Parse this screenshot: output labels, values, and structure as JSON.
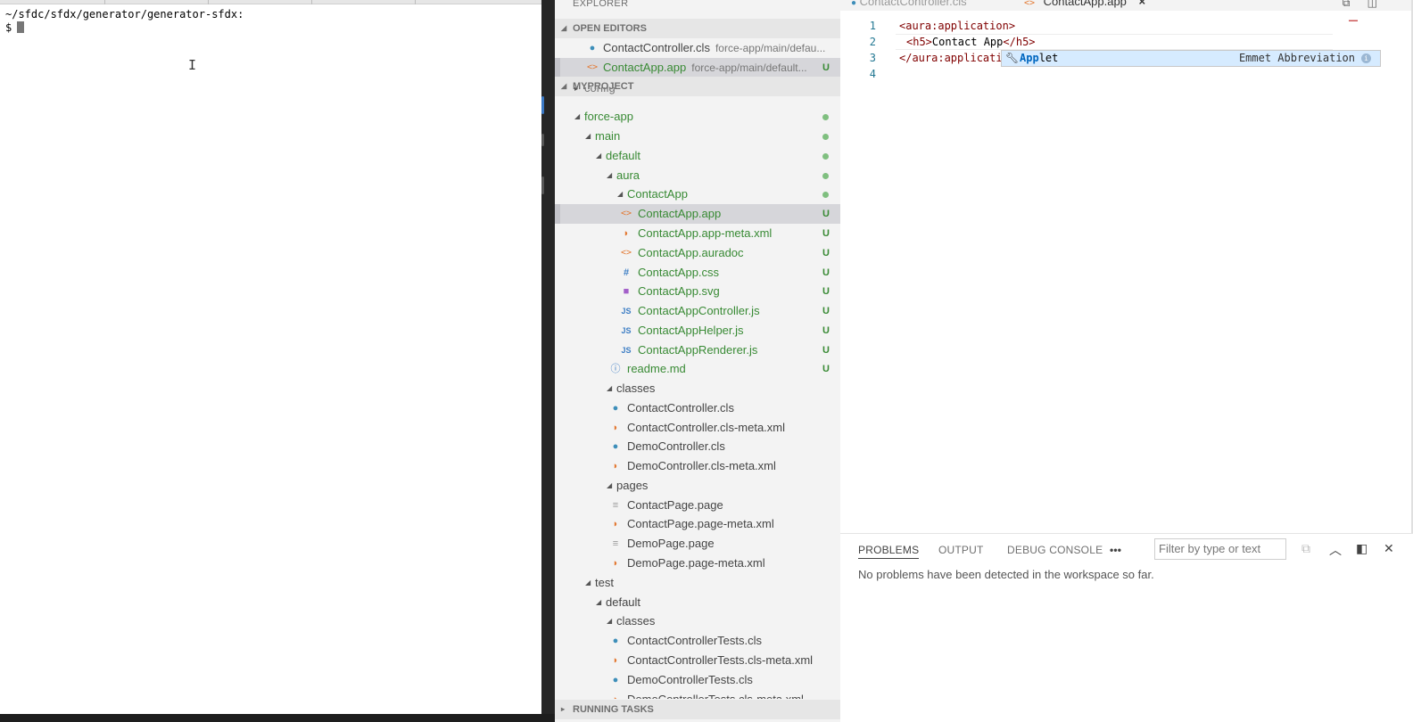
{
  "terminal": {
    "path_line": "~/sfdc/sfdx/generator/generator-sfdx:",
    "prompt": "$"
  },
  "explorer": {
    "title": "EXPLORER",
    "open_editors_label": "OPEN EDITORS",
    "open_editors": [
      {
        "name": "ContactController.cls",
        "path": "force-app/main/defau...",
        "icon": "apex-class-icon",
        "badge": ""
      },
      {
        "name": "ContactApp.app",
        "path": "force-app/main/default...",
        "icon": "html-tag-icon",
        "badge": "U"
      }
    ],
    "project_label": "MYPROJECT",
    "tree": [
      {
        "name": "config",
        "icon": "",
        "badge": ""
      },
      {
        "name": "force-app",
        "icon": "",
        "badge": "dot"
      },
      {
        "name": "main",
        "icon": "",
        "badge": "dot"
      },
      {
        "name": "default",
        "icon": "",
        "badge": "dot"
      },
      {
        "name": "aura",
        "icon": "",
        "badge": "dot"
      },
      {
        "name": "ContactApp",
        "icon": "",
        "badge": "dot"
      },
      {
        "name": "ContactApp.app",
        "icon": "html-tag-icon",
        "badge": "U"
      },
      {
        "name": "ContactApp.app-meta.xml",
        "icon": "rss-icon",
        "badge": "U"
      },
      {
        "name": "ContactApp.auradoc",
        "icon": "html-tag-icon",
        "badge": "U"
      },
      {
        "name": "ContactApp.css",
        "icon": "hash-icon",
        "badge": "U"
      },
      {
        "name": "ContactApp.svg",
        "icon": "svg-icon",
        "badge": "U"
      },
      {
        "name": "ContactAppController.js",
        "icon": "js-icon",
        "badge": "U"
      },
      {
        "name": "ContactAppHelper.js",
        "icon": "js-icon",
        "badge": "U"
      },
      {
        "name": "ContactAppRenderer.js",
        "icon": "js-icon",
        "badge": "U"
      },
      {
        "name": "readme.md",
        "icon": "info-icon",
        "badge": "U"
      },
      {
        "name": "classes",
        "icon": "",
        "badge": ""
      },
      {
        "name": "ContactController.cls",
        "icon": "apex-class-icon",
        "badge": ""
      },
      {
        "name": "ContactController.cls-meta.xml",
        "icon": "rss-icon",
        "badge": ""
      },
      {
        "name": "DemoController.cls",
        "icon": "apex-class-icon",
        "badge": ""
      },
      {
        "name": "DemoController.cls-meta.xml",
        "icon": "rss-icon",
        "badge": ""
      },
      {
        "name": "pages",
        "icon": "",
        "badge": ""
      },
      {
        "name": "ContactPage.page",
        "icon": "page-icon",
        "badge": ""
      },
      {
        "name": "ContactPage.page-meta.xml",
        "icon": "rss-icon",
        "badge": ""
      },
      {
        "name": "DemoPage.page",
        "icon": "page-icon",
        "badge": ""
      },
      {
        "name": "DemoPage.page-meta.xml",
        "icon": "rss-icon",
        "badge": ""
      },
      {
        "name": "test",
        "icon": "",
        "badge": ""
      },
      {
        "name": "default",
        "icon": "",
        "badge": ""
      },
      {
        "name": "classes",
        "icon": "",
        "badge": ""
      },
      {
        "name": "ContactControllerTests.cls",
        "icon": "apex-class-icon",
        "badge": ""
      },
      {
        "name": "ContactControllerTests.cls-meta.xml",
        "icon": "rss-icon",
        "badge": ""
      },
      {
        "name": "DemoControllerTests.cls",
        "icon": "apex-class-icon",
        "badge": ""
      },
      {
        "name": "DemoControllerTests.cls-meta.xml",
        "icon": "rss-icon",
        "badge": ""
      }
    ],
    "running_tasks_label": "RUNNING TASKS"
  },
  "editor": {
    "tabs": [
      {
        "label": "ContactController.cls",
        "active": false
      },
      {
        "label": "ContactApp.app",
        "active": true
      }
    ],
    "close_glyph": "×",
    "line_numbers": [
      "1",
      "2",
      "3",
      "4"
    ],
    "code": {
      "line1": "<aura:application>",
      "line2_open": "<h5>",
      "line2_text": "Contact App",
      "line2_close": "</h5>",
      "line3": "</aura:applicati"
    },
    "suggestion": {
      "match": "App",
      "rest": "let",
      "detail": "Emmet Abbreviation"
    }
  },
  "panel": {
    "tabs": [
      "PROBLEMS",
      "OUTPUT",
      "DEBUG CONSOLE"
    ],
    "more": "•••",
    "filter_placeholder": "Filter by type or text",
    "message": "No problems have been detected in the workspace so far."
  },
  "colors": {
    "git_untracked": "#388a34",
    "selection": "#d6d6da",
    "suggest_bg": "#d6ebff"
  }
}
